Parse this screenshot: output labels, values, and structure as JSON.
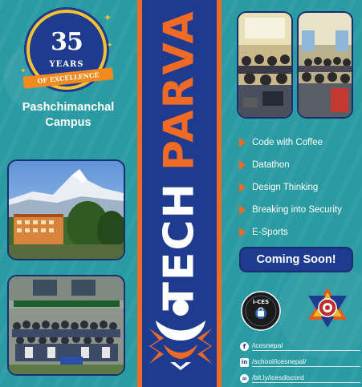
{
  "badge": {
    "number": "35",
    "line1": "YEARS",
    "ribbon": "OF EXCELLENCE"
  },
  "campus": {
    "name_line1": "Pashchimanchal",
    "name_line2": "Campus"
  },
  "brand": {
    "word1": "TECH",
    "word2": "PARVA"
  },
  "events": [
    {
      "label": "Code with Coffee"
    },
    {
      "label": "Datathon"
    },
    {
      "label": "Design Thinking"
    },
    {
      "label": "Breaking into Security"
    },
    {
      "label": "E-Sports"
    }
  ],
  "cta": {
    "label": "Coming Soon!"
  },
  "logos": {
    "ices_text": "i-CES"
  },
  "socials": [
    {
      "icon": "facebook-icon",
      "text": "/icesnepal"
    },
    {
      "icon": "linkedin-icon",
      "text": "/school/icesnepal/"
    },
    {
      "icon": "link-icon",
      "text": "/bit.ly/icesdiscord"
    }
  ],
  "colors": {
    "background": "#2a9aa3",
    "navy": "#1f3b8f",
    "orange": "#ef6a25",
    "gold": "#f1c233"
  }
}
